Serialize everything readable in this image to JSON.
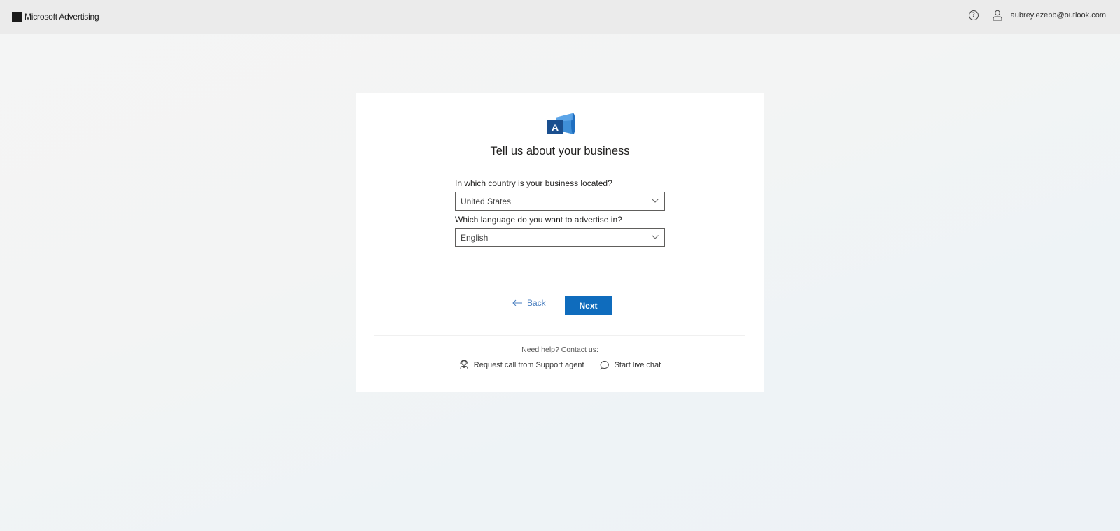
{
  "header": {
    "brand": "Microsoft Advertising",
    "help_icon": "question-circle-icon",
    "user_icon": "person-icon",
    "user_email": "aubrey.ezebb@outlook.com"
  },
  "card": {
    "logo_icon": "microsoft-advertising-megaphone-icon",
    "logo_letter": "A",
    "title": "Tell us about your business",
    "country": {
      "label": "In which country is your business located?",
      "value": "United States"
    },
    "language": {
      "label": "Which language do you want to advertise in?",
      "value": "English"
    },
    "back_label": "Back",
    "next_label": "Next",
    "help_text": "Need help? Contact us:",
    "contact_call": "Request call from Support agent",
    "contact_chat": "Start live chat"
  },
  "colors": {
    "primary": "#0f6cbd",
    "link": "#4a7fc0",
    "topbar": "#ebebeb"
  }
}
